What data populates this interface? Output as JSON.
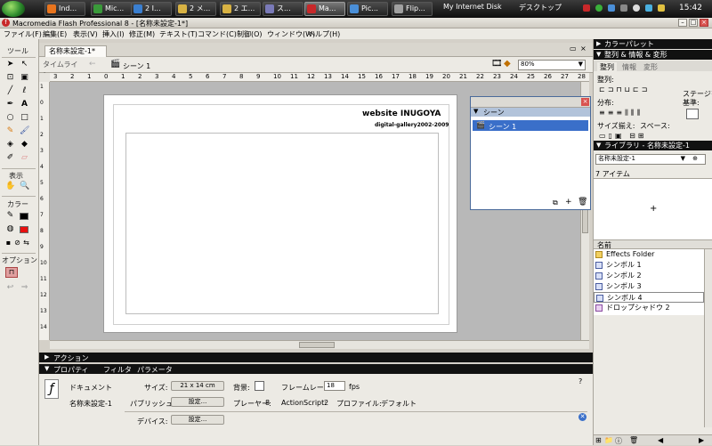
{
  "taskbar": {
    "buttons": [
      {
        "label": "Ind...",
        "icon": "firefox-icon",
        "color": "#e8741d"
      },
      {
        "label": "Mic...",
        "icon": "messenger-icon",
        "color": "#3a9a3a"
      },
      {
        "label": "2 I...",
        "icon": "ie-icon",
        "color": "#3a7fd0"
      },
      {
        "label": "2 メ...",
        "icon": "folder-icon",
        "color": "#d8b243"
      },
      {
        "label": "2 エ...",
        "icon": "explorer-icon",
        "color": "#d8b243"
      },
      {
        "label": "ス...",
        "icon": "scanner-icon",
        "color": "#7a7ab8"
      },
      {
        "label": "Ma...",
        "icon": "macromedia-icon",
        "color": "#c8282a"
      },
      {
        "label": "Pic...",
        "icon": "picasa-icon",
        "color": "#4a8fd8"
      },
      {
        "label": "Flip...",
        "icon": "flip-icon",
        "color": "#a0a0a0"
      }
    ],
    "tray_labels": [
      "My Internet Disk",
      "デスクトップ"
    ],
    "clock": "15:42"
  },
  "window": {
    "title": "Macromedia Flash Professional 8 - [名称未設定-1*]"
  },
  "menu": [
    "ファイル(F)",
    "編集(E)",
    "表示(V)",
    "挿入(I)",
    "修正(M)",
    "テキスト(T)",
    "コマンド(C)",
    "制御(O)",
    "ウィンドウ(W)",
    "ヘルプ(H)"
  ],
  "tools": {
    "title": "ツール",
    "view_label": "表示",
    "color_label": "カラー",
    "options_label": "オプション"
  },
  "document": {
    "tab": "名称未設定-1*",
    "timeline_btn": "タイムライン",
    "scene_label": "シーン 1",
    "zoom": "80%"
  },
  "ruler_ticks": [
    "3",
    "2",
    "1",
    "0",
    "1",
    "2",
    "3",
    "4",
    "5",
    "6",
    "7",
    "8",
    "9",
    "10",
    "11",
    "12",
    "13",
    "14",
    "15",
    "16",
    "17",
    "18",
    "19",
    "20",
    "21",
    "22",
    "23",
    "24",
    "25",
    "26",
    "27",
    "28"
  ],
  "ruler_left_ticks": [
    "1",
    "0",
    "1",
    "2",
    "3",
    "4",
    "5",
    "6",
    "7",
    "8",
    "9",
    "10",
    "11",
    "12",
    "13",
    "14"
  ],
  "stage": {
    "title": "website INUGOYA",
    "subtitle": "digital-gallery2002-2009"
  },
  "scene_panel": {
    "title": "シーン",
    "item": "シーン 1"
  },
  "actions_panel": {
    "title": "アクション"
  },
  "properties": {
    "tabs": [
      "プロパティ",
      "フィルタ",
      "パラメータ"
    ],
    "doc_label": "ドキュメント",
    "doc_name": "名称未設定-1",
    "size_label": "サイズ:",
    "size_value": "21 x 14 cm",
    "bg_label": "背景:",
    "framerate_label": "フレームレート:",
    "framerate_value": "18",
    "fps": "fps",
    "publish_label": "パブリッシュ:",
    "settings_btn": "設定...",
    "player_label": "プレーヤー:",
    "player_value": "8",
    "as_label": "ActionScript:",
    "as_value": "2",
    "profile_label": "プロファイル:",
    "profile_value": "デフォルト",
    "device_label": "デバイス:",
    "device_btn": "設定..."
  },
  "right": {
    "color_palette": "カラーパレット",
    "align_panel": "整列 & 情報 & 変形",
    "align_tabs": [
      "整列",
      "情報",
      "変形"
    ],
    "align_label": "整列:",
    "distribute_label": "分布:",
    "size_match_label": "サイズ揃え:",
    "space_label": "スペース:",
    "stage_label_1": "ステージを",
    "stage_label_2": "基準:",
    "library_panel": "ライブラリ - 名称未設定-1",
    "library_select": "名称未設定-1",
    "item_count": "7 アイテム",
    "name_header": "名前",
    "items": [
      "Effects Folder",
      "シンボル 1",
      "シンボル 2",
      "シンボル 3",
      "シンボル 4",
      "ドロップシャドウ 2"
    ]
  }
}
